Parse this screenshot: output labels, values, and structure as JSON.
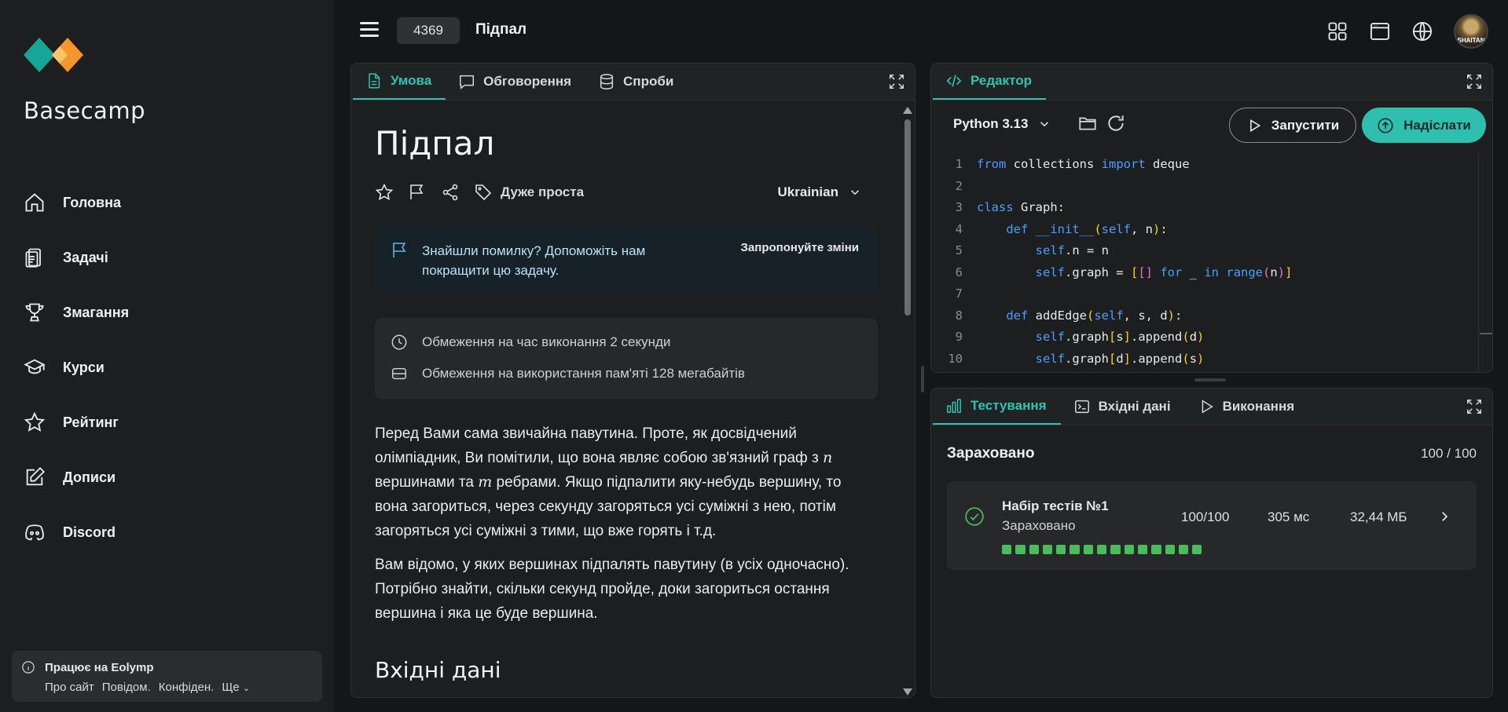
{
  "sidebar": {
    "brand": "Basecamp",
    "items": [
      {
        "label": "Головна",
        "icon": "home-icon"
      },
      {
        "label": "Задачі",
        "icon": "clipboard-icon"
      },
      {
        "label": "Змагання",
        "icon": "trophy-icon"
      },
      {
        "label": "Курси",
        "icon": "graduation-cap-icon"
      },
      {
        "label": "Рейтинг",
        "icon": "star-icon"
      },
      {
        "label": "Дописи",
        "icon": "edit-icon"
      },
      {
        "label": "Discord",
        "icon": "discord-icon"
      }
    ],
    "footer": {
      "title": "Працює на Eolymp",
      "links": [
        "Про сайт",
        "Повідом.",
        "Конфіден.",
        "Ще"
      ]
    }
  },
  "topbar": {
    "problem_id": "4369",
    "problem_title": "Підпал"
  },
  "left_panel": {
    "tabs": [
      "Умова",
      "Обговорення",
      "Спроби"
    ],
    "title": "Підпал",
    "difficulty": "Дуже проста",
    "language": "Ukrainian",
    "notice": {
      "message": "Знайшли помилку? Допоможіть нам покращити цю задачу.",
      "action": "Запропонуйте зміни"
    },
    "limits": {
      "time": "Обмеження на час виконання 2 секунди",
      "memory": "Обмеження на використання пам'яті 128 мегабайтів"
    },
    "statement_p1_a": "Перед Вами сама звичайна павутина. Проте, як досвідчений олімпіадник, Ви помітили, що вона являє собою зв'язний граф з ",
    "var_n": "n",
    "statement_p1_b": " вершинами та ",
    "var_m": "m",
    "statement_p1_c": " ребрами. Якщо підпалити яку-небудь вершину, то вона загориться, через секунду загоряться усі суміжні з нею, потім загоряться усі суміжні з тими, що вже горять і т.д.",
    "statement_p2": "Вам відомо, у яких вершинах підпалять павутину (в усіх одночасно). Потрібно знайти, скільки секунд пройде, доки загориться остання вершина і яка це буде вершина.",
    "input_heading": "Вхідні дані"
  },
  "editor": {
    "tab": "Редактор",
    "python_version": "Python 3.13",
    "run_label": "Запустити",
    "submit_label": "Надіслати",
    "line_numbers": [
      "1",
      "2",
      "3",
      "4",
      "5",
      "6",
      "7",
      "8",
      "9",
      "10"
    ]
  },
  "testing": {
    "tabs": [
      "Тестування",
      "Вхідні дані",
      "Виконання"
    ],
    "result": "Зараховано",
    "score": "100 / 100",
    "testset": {
      "name": "Набір тестів №1",
      "status": "Зараховано",
      "points": "100/100",
      "time": "305 мс",
      "memory": "32,44 МБ",
      "passed_tests": 15
    }
  },
  "colors": {
    "accent": "#2fc4b2",
    "success": "#4cbb5c",
    "background": "#141617",
    "panel": "#1c1e1f"
  }
}
